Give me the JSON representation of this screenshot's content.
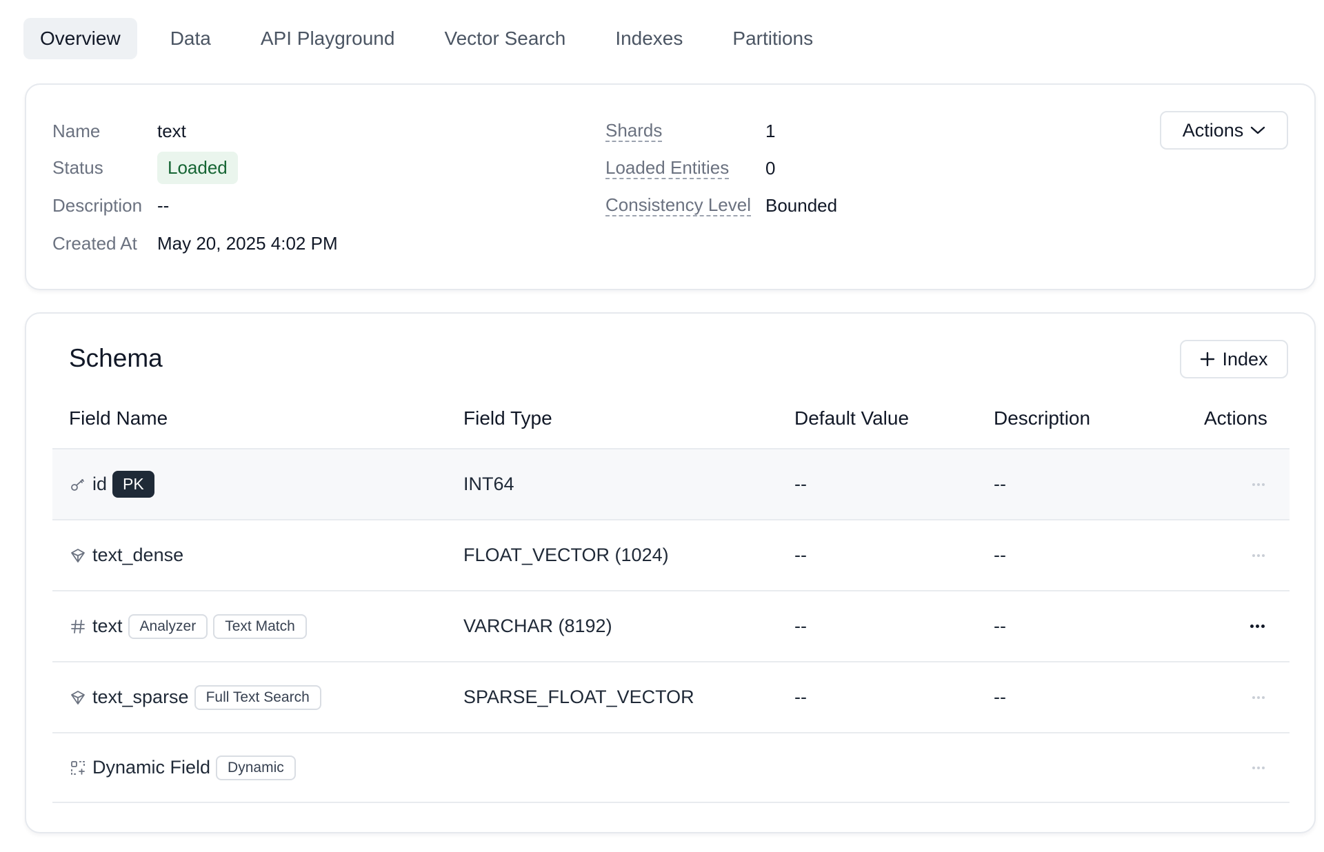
{
  "tabs": [
    {
      "label": "Overview",
      "active": true
    },
    {
      "label": "Data"
    },
    {
      "label": "API Playground"
    },
    {
      "label": "Vector Search"
    },
    {
      "label": "Indexes"
    },
    {
      "label": "Partitions"
    }
  ],
  "info": {
    "name_label": "Name",
    "name_value": "text",
    "status_label": "Status",
    "status_value": "Loaded",
    "description_label": "Description",
    "description_value": "--",
    "created_label": "Created At",
    "created_value": "May 20, 2025 4:02 PM",
    "shards_label": "Shards",
    "shards_value": "1",
    "entities_label": "Loaded Entities",
    "entities_value": "0",
    "consistency_label": "Consistency Level",
    "consistency_value": "Bounded",
    "actions_label": "Actions"
  },
  "schema": {
    "title": "Schema",
    "add_index_label": "Index",
    "columns": [
      "Field Name",
      "Field Type",
      "Default Value",
      "Description",
      "Actions"
    ],
    "rows": [
      {
        "icon": "key-icon",
        "name": "id",
        "tags": [],
        "pk": "PK",
        "type": "INT64",
        "default": "--",
        "description": "--"
      },
      {
        "icon": "vector-icon",
        "name": "text_dense",
        "tags": [],
        "type": "FLOAT_VECTOR (1024)",
        "default": "--",
        "description": "--"
      },
      {
        "icon": "hash-icon",
        "name": "text",
        "tags": [
          "Analyzer",
          "Text Match"
        ],
        "type": "VARCHAR (8192)",
        "default": "--",
        "description": "--"
      },
      {
        "icon": "vector-icon",
        "name": "text_sparse",
        "tags": [
          "Full Text Search"
        ],
        "type": "SPARSE_FLOAT_VECTOR",
        "default": "--",
        "description": "--"
      },
      {
        "icon": "dynamic-field-icon",
        "name": "Dynamic Field",
        "tags": [
          "Dynamic"
        ],
        "type": "",
        "default": "",
        "description": ""
      }
    ]
  }
}
